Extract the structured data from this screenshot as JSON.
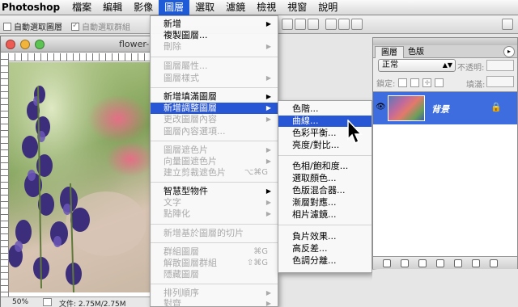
{
  "menubar": {
    "app": "Photoshop",
    "items": [
      "檔案",
      "編輯",
      "影像",
      "圖層",
      "選取",
      "濾鏡",
      "檢視",
      "視窗",
      "說明"
    ],
    "active_index": 3
  },
  "optionsbar": {
    "auto_select_layer": "自動選取圖層",
    "auto_select_group": "自動選取群組"
  },
  "document": {
    "title": "flower-",
    "zoom": "50%",
    "doc_size": "文件: 2.75M/2.75M"
  },
  "layer_menu": {
    "items": [
      {
        "label": "新增",
        "disabled": false,
        "submenu": true
      },
      {
        "label": "複製圖層...",
        "disabled": false
      },
      {
        "label": "刪除",
        "disabled": true,
        "submenu": true
      },
      {
        "label": "圖層屬性...",
        "disabled": true
      },
      {
        "label": "圖層樣式",
        "disabled": true,
        "submenu": true
      },
      {
        "label": "新增填滿圖層",
        "disabled": false,
        "submenu": true
      },
      {
        "label": "新增調整圖層",
        "disabled": false,
        "submenu": true,
        "highlighted": true
      },
      {
        "label": "更改圖層內容",
        "disabled": true,
        "submenu": true
      },
      {
        "label": "圖層內容選項...",
        "disabled": true
      },
      {
        "label": "圖層遮色片",
        "disabled": true,
        "submenu": true
      },
      {
        "label": "向量圖遮色片",
        "disabled": true,
        "submenu": true
      },
      {
        "label": "建立剪裁遮色片",
        "disabled": true,
        "shortcut": "⌥⌘G"
      },
      {
        "label": "智慧型物件",
        "disabled": false,
        "submenu": true
      },
      {
        "label": "文字",
        "disabled": true,
        "submenu": true
      },
      {
        "label": "點陣化",
        "disabled": true,
        "submenu": true
      },
      {
        "label": "新增基於圖層的切片",
        "disabled": true
      },
      {
        "label": "群組圖層",
        "disabled": true,
        "shortcut": "⌘G"
      },
      {
        "label": "解散圖層群組",
        "disabled": true,
        "shortcut": "⇧⌘G"
      },
      {
        "label": "隱藏圖層",
        "disabled": true
      },
      {
        "label": "排列順序",
        "disabled": true,
        "submenu": true
      },
      {
        "label": "對齊",
        "disabled": true,
        "submenu": true
      }
    ]
  },
  "adjustment_submenu": {
    "items": [
      {
        "label": "色階..."
      },
      {
        "label": "曲線...",
        "highlighted": true
      },
      {
        "label": "色彩平衡..."
      },
      {
        "label": "亮度/對比..."
      },
      {
        "label": "色相/飽和度..."
      },
      {
        "label": "選取顏色..."
      },
      {
        "label": "色版混合器..."
      },
      {
        "label": "漸層對應..."
      },
      {
        "label": "相片濾鏡..."
      },
      {
        "label": "負片效果..."
      },
      {
        "label": "高反差..."
      },
      {
        "label": "色調分離..."
      }
    ]
  },
  "layers_panel": {
    "tabs": [
      "圖層",
      "色版"
    ],
    "blend_mode": "正常",
    "opacity_label": "不透明:",
    "lock_label": "鎖定:",
    "fill_label": "填滿:",
    "layer_name": "背景"
  },
  "colors": {
    "highlight": "#2857d5",
    "menu_bg": "#f8f8f8"
  }
}
